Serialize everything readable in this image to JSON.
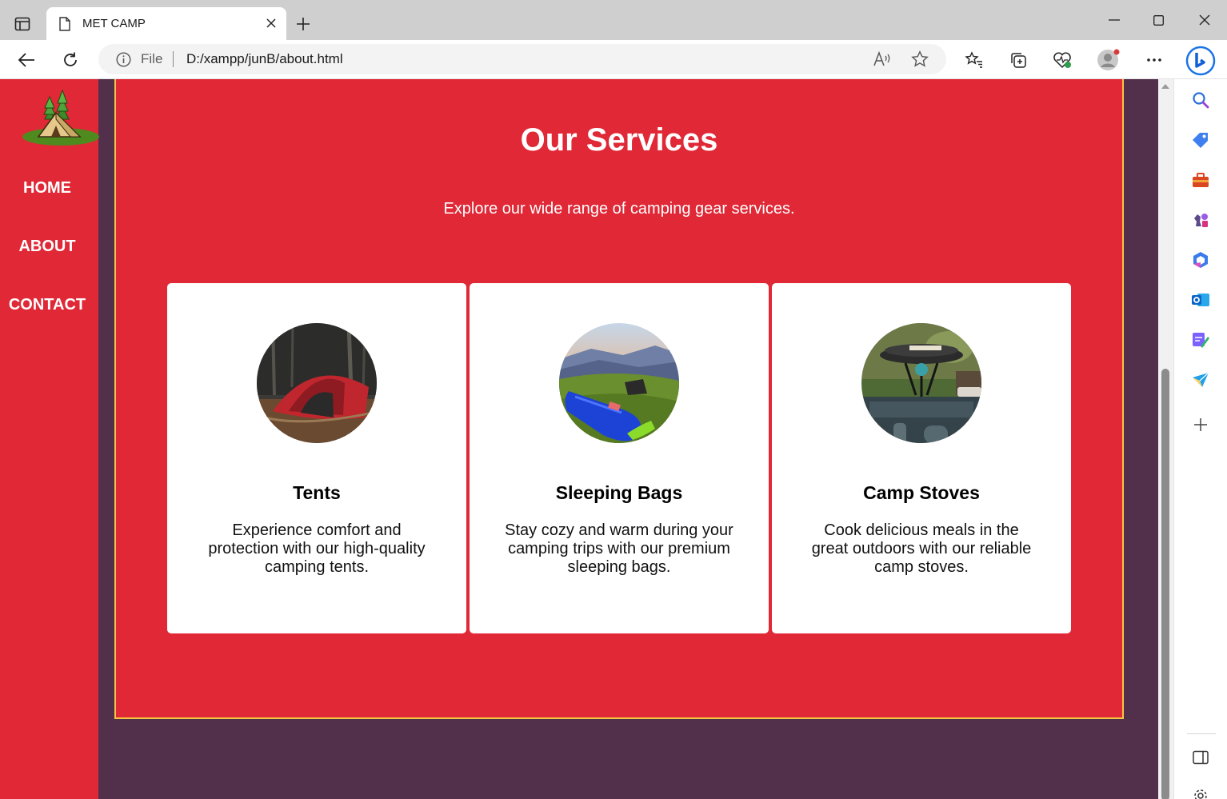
{
  "browser": {
    "tab_title": "MET CAMP",
    "url_scheme": "File",
    "url": "D:/xampp/junB/about.html"
  },
  "nav": {
    "items": [
      "HOME",
      "ABOUT",
      "CONTACT"
    ]
  },
  "services": {
    "title": "Our Services",
    "lead": "Explore our wide range of camping gear services.",
    "cards": [
      {
        "title": "Tents",
        "text": "Experience comfort and protection with our high-quality camping tents."
      },
      {
        "title": "Sleeping Bags",
        "text": "Stay cozy and warm during your camping trips with our premium sleeping bags."
      },
      {
        "title": "Camp Stoves",
        "text": "Cook delicious meals in the great outdoors with our reliable camp stoves."
      }
    ]
  },
  "colors": {
    "accent_red": "#e02836",
    "page_bg": "#52304b",
    "border_yellow": "#f5c542"
  }
}
